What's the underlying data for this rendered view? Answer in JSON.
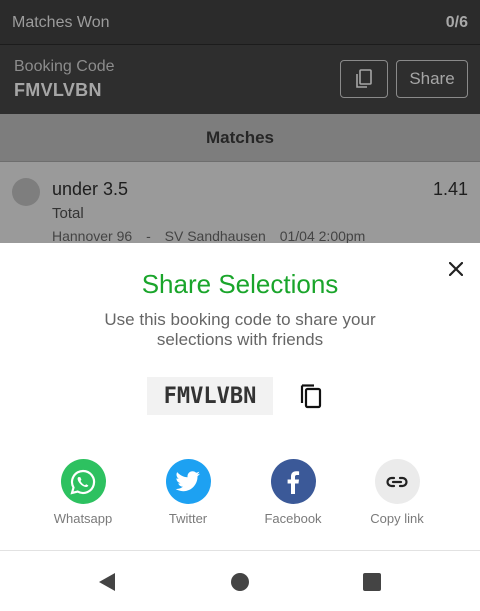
{
  "background": {
    "matches_won": {
      "label": "Matches Won",
      "value": "0/6"
    },
    "booking": {
      "label": "Booking Code",
      "code": "FMVLVBN",
      "share_label": "Share"
    },
    "matches_header": "Matches",
    "selection": {
      "pick": "under 3.5",
      "odds": "1.41",
      "market": "Total",
      "home": "Hannover 96",
      "separator": "-",
      "away": "SV Sandhausen",
      "datetime": "01/04 2:00pm"
    }
  },
  "sheet": {
    "title": "Share Selections",
    "subtitle": "Use this booking code to share your selections with friends",
    "code": "FMVLVBN",
    "accent": "#1aa52b",
    "share_options": [
      {
        "label": "Whatsapp",
        "icon": "whatsapp-icon",
        "color": "#2dc160"
      },
      {
        "label": "Twitter",
        "icon": "twitter-icon",
        "color": "#1da1f2"
      },
      {
        "label": "Facebook",
        "icon": "facebook-icon",
        "color": "#3b5998"
      },
      {
        "label": "Copy link",
        "icon": "link-icon",
        "color": "#ebebeb"
      }
    ]
  },
  "navbar": {
    "back": "back-icon",
    "home": "home-icon",
    "recents": "recents-icon"
  }
}
